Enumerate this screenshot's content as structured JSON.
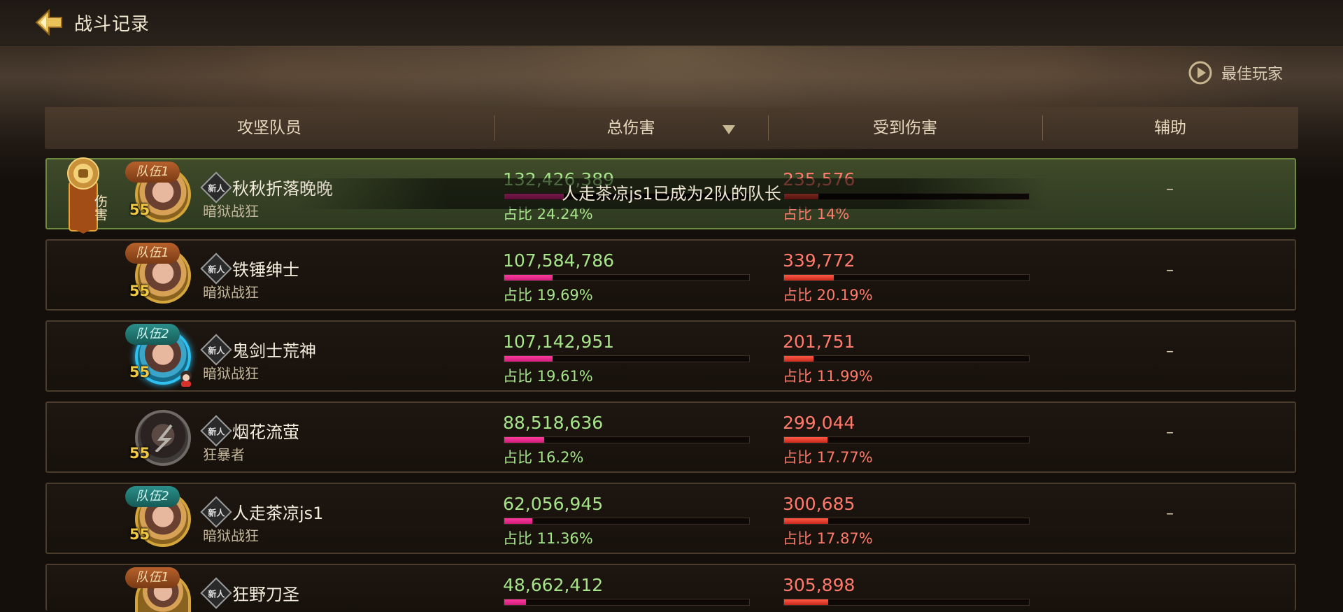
{
  "title": "战斗记录",
  "best_player": "最佳玩家",
  "columns": {
    "member": "攻坚队员",
    "total_damage": "总伤害",
    "damage_taken": "受到伤害",
    "assist": "辅助"
  },
  "badge_new": "新人",
  "medal_label": "伤害",
  "toast": "人走茶凉js1已成为2队的队长",
  "rows": [
    {
      "team": "队伍1",
      "level": "55",
      "name": "秋秋折落晚晚",
      "class": "暗狱战狂",
      "damage": "132,426,389",
      "damage_pct": "占比 24.24%",
      "taken": "235,576",
      "taken_pct": "占比 14%",
      "assist": "–"
    },
    {
      "team": "队伍1",
      "level": "55",
      "name": "铁锤绅士",
      "class": "暗狱战狂",
      "damage": "107,584,786",
      "damage_pct": "占比 19.69%",
      "taken": "339,772",
      "taken_pct": "占比 20.19%",
      "assist": "–"
    },
    {
      "team": "队伍2",
      "level": "55",
      "name": "鬼剑士荒神",
      "class": "暗狱战狂",
      "damage": "107,142,951",
      "damage_pct": "占比 19.61%",
      "taken": "201,751",
      "taken_pct": "占比 11.99%",
      "assist": "–"
    },
    {
      "team": "",
      "level": "55",
      "name": "烟花流萤",
      "class": "狂暴者",
      "damage": "88,518,636",
      "damage_pct": "占比 16.2%",
      "taken": "299,044",
      "taken_pct": "占比 17.77%",
      "assist": "–"
    },
    {
      "team": "队伍2",
      "level": "55",
      "name": "人走茶凉js1",
      "class": "暗狱战狂",
      "damage": "62,056,945",
      "damage_pct": "占比 11.36%",
      "taken": "300,685",
      "taken_pct": "占比 17.87%",
      "assist": "–"
    },
    {
      "team": "队伍1",
      "level": "",
      "name": "狂野刀圣",
      "class": "",
      "damage": "48,662,412",
      "damage_pct": "",
      "taken": "305,898",
      "taken_pct": "",
      "assist": ""
    }
  ],
  "bar_fractions": {
    "damage": [
      0.2424,
      0.1969,
      0.1961,
      0.162,
      0.1136,
      0.089
    ],
    "taken": [
      0.14,
      0.2019,
      0.1199,
      0.1777,
      0.1787,
      0.18
    ]
  },
  "colors": {
    "damage_text": "#a6e48a",
    "taken_text": "#ff7a6a",
    "damage_bar": "#e0208a",
    "taken_bar": "#e0392a",
    "highlight_row": "#3f4a2a"
  }
}
